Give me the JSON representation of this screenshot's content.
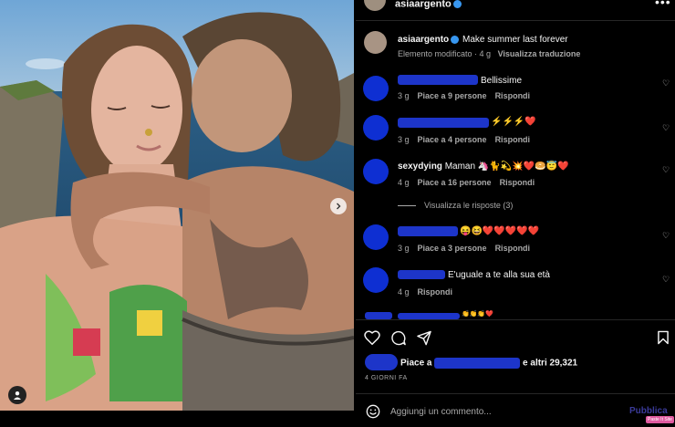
{
  "post": {
    "username": "asiaargento",
    "more_icon": "more-icon"
  },
  "caption": {
    "username": "asiaargento",
    "text": "Make summer last forever",
    "edited": "Elemento modificato · 4 g",
    "translate": "Visualizza traduzione"
  },
  "comments": [
    {
      "text": "Bellissime",
      "time": "3 g",
      "likes": "Piace a 9 persone",
      "reply": "Rispondi"
    },
    {
      "text": "⚡⚡⚡❤️",
      "time": "3 g",
      "likes": "Piace a 4 persone",
      "reply": "Rispondi"
    },
    {
      "username": "sexydying",
      "text": "Maman 🦄🐈💫💥❤️🥯😇❤️",
      "time": "4 g",
      "likes": "Piace a 16 persone",
      "reply": "Rispondi"
    },
    {
      "text": "😝😆❤️❤️❤️❤️❤️",
      "time": "3 g",
      "likes": "Piace a 3 persone",
      "reply": "Rispondi"
    },
    {
      "text": "E'uguale a te alla sua età",
      "time": "4 g",
      "reply": "Rispondi"
    },
    {
      "text": "👏👏👏❤️"
    }
  ],
  "view_replies": "Visualizza le risposte (3)",
  "likes_summary": {
    "prefix": "Piace a",
    "suffix": "e altri 29,321"
  },
  "time_ago": "4 GIORNI FA",
  "comment_input": {
    "placeholder": "Aggiungi un commento..."
  },
  "publish": "Pubblica",
  "watermark": "Paste It Site",
  "colors": {
    "background": "#000000",
    "redaction": "#0e2fd2",
    "verified": "#3897f0"
  }
}
